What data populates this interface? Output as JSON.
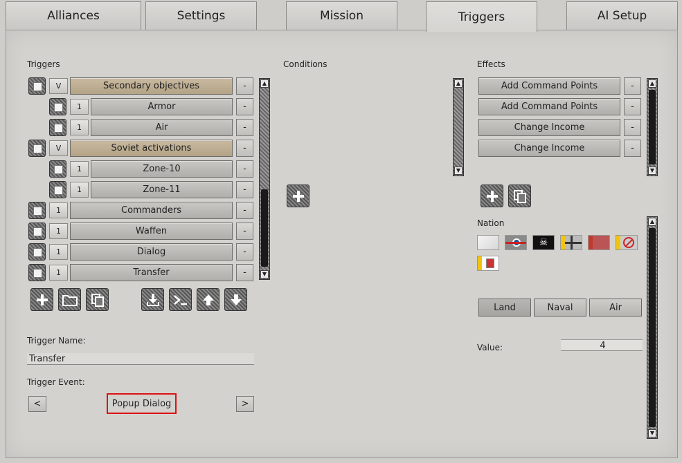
{
  "tabs": [
    "Alliances",
    "Settings",
    "Mission",
    "Triggers",
    "AI Setup"
  ],
  "triggers": {
    "heading": "Triggers",
    "rows": [
      {
        "count": "V",
        "label": "Secondary objectives",
        "tan": true,
        "indent": false
      },
      {
        "count": "1",
        "label": "Armor",
        "tan": false,
        "indent": true
      },
      {
        "count": "1",
        "label": "Air",
        "tan": false,
        "indent": true
      },
      {
        "count": "V",
        "label": "Soviet activations",
        "tan": true,
        "indent": false
      },
      {
        "count": "1",
        "label": "Zone-10",
        "tan": false,
        "indent": true
      },
      {
        "count": "1",
        "label": "Zone-11",
        "tan": false,
        "indent": true
      },
      {
        "count": "1",
        "label": "Commanders",
        "tan": false,
        "indent": false
      },
      {
        "count": "1",
        "label": "Waffen",
        "tan": false,
        "indent": false
      },
      {
        "count": "1",
        "label": "Dialog",
        "tan": false,
        "indent": false
      },
      {
        "count": "1",
        "label": "Transfer",
        "tan": false,
        "indent": false
      }
    ],
    "minus": "-"
  },
  "conditions": {
    "heading": "Conditions"
  },
  "effects": {
    "heading": "Effects",
    "rows": [
      "Add Command Points",
      "Add Command Points",
      "Change Income",
      "Change Income"
    ],
    "minus": "-"
  },
  "trigger_name": {
    "label": "Trigger Name:",
    "value": "Transfer"
  },
  "trigger_event": {
    "label": "Trigger Event:",
    "value": "Popup Dialog",
    "prev": "<",
    "next": ">"
  },
  "nation": {
    "label": "Nation"
  },
  "domains": [
    "Land",
    "Naval",
    "Air"
  ],
  "value": {
    "label": "Value:",
    "value": "4"
  }
}
